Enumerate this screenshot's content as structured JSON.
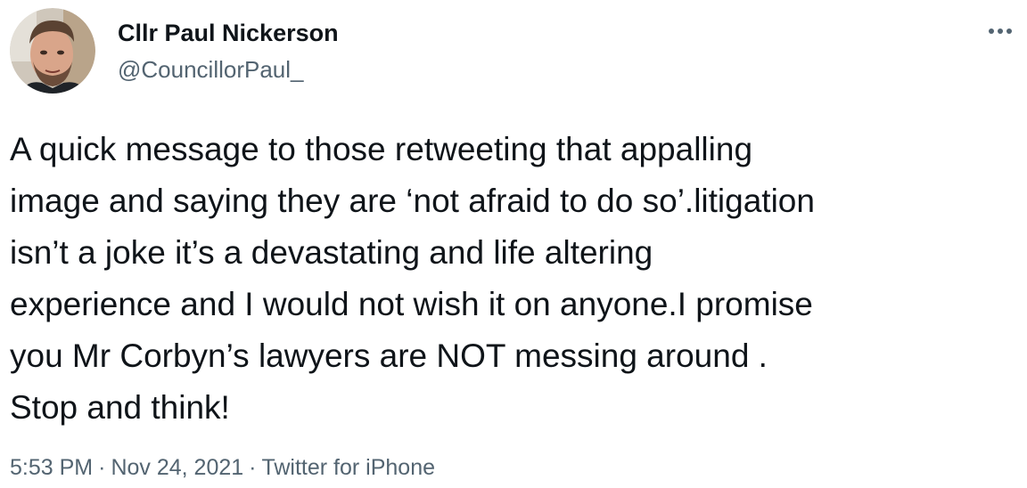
{
  "tweet": {
    "author": {
      "display_name": "Cllr Paul Nickerson",
      "handle": "@CouncillorPaul_",
      "avatar_icon": "profile-photo"
    },
    "more_icon": "more-options-icon",
    "text": "A quick message to those retweeting that appalling\nimage and saying they are ‘not afraid to do so’.litigation\nisn’t a joke it’s a devastating and life altering\nexperience and I would not wish it on anyone.I promise\nyou Mr Corbyn’s lawyers are NOT messing around .\nStop and think!",
    "meta": {
      "time": "5:53 PM",
      "separator": "·",
      "date": "Nov 24, 2021",
      "source": "Twitter for iPhone"
    }
  },
  "colors": {
    "primary_text": "#0f1419",
    "secondary_text": "#536471"
  }
}
